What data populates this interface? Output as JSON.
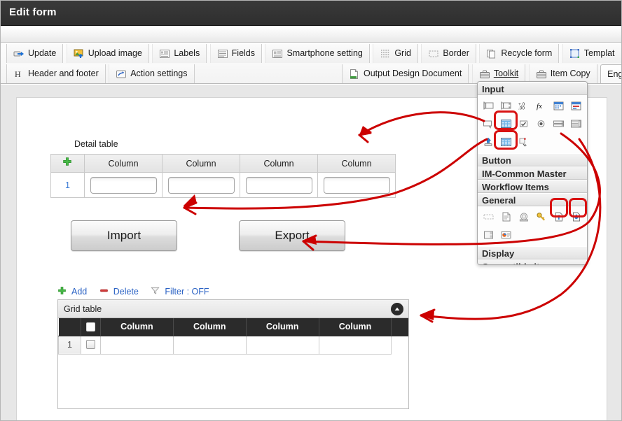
{
  "window": {
    "title": "Edit form"
  },
  "toolbar": {
    "row1": [
      {
        "label": "Update",
        "icon": "update-icon"
      },
      {
        "label": "Upload image",
        "icon": "upload-image-icon"
      },
      {
        "label": "Labels",
        "icon": "labels-icon"
      },
      {
        "label": "Fields",
        "icon": "fields-icon"
      },
      {
        "label": "Smartphone setting",
        "icon": "smartphone-setting-icon"
      },
      {
        "label": "Grid",
        "icon": "grid-icon"
      },
      {
        "label": "Border",
        "icon": "border-icon"
      },
      {
        "label": "Recycle form",
        "icon": "recycle-form-icon"
      },
      {
        "label": "Templat",
        "icon": "template-icon"
      }
    ],
    "row2_left": [
      {
        "label": "Header and footer",
        "icon": "header-footer-icon"
      },
      {
        "label": "Action settings",
        "icon": "action-settings-icon"
      }
    ],
    "row2_right": [
      {
        "label": "Output Design Document",
        "icon": "output-design-document-icon"
      },
      {
        "label": "Toolkit",
        "icon": "toolkit-icon"
      },
      {
        "label": "Item Copy",
        "icon": "item-copy-icon"
      },
      {
        "label": "Eng",
        "icon": "language-icon"
      }
    ]
  },
  "form": {
    "detail_table": {
      "label": "Detail table",
      "add_icon": "plus-icon",
      "columns": [
        "Column",
        "Column",
        "Column",
        "Column"
      ],
      "rows": [
        {
          "number": "1",
          "values": [
            "",
            "",
            "",
            ""
          ]
        }
      ]
    },
    "buttons": {
      "import": "Import",
      "export": "Export"
    },
    "grid_toolbar": [
      {
        "label": "Add",
        "icon": "plus-icon"
      },
      {
        "label": "Delete",
        "icon": "minus-icon"
      },
      {
        "label": "Filter : OFF",
        "icon": "filter-icon"
      }
    ],
    "grid_table": {
      "title": "Grid table",
      "collapse_icon": "chevron-up-icon",
      "columns": [
        "Column",
        "Column",
        "Column",
        "Column"
      ],
      "rows": [
        {
          "number": "1"
        }
      ]
    }
  },
  "toolkit_panel": {
    "sections": [
      {
        "name": "Input"
      },
      {
        "name": "Button"
      },
      {
        "name": "IM-Common Master"
      },
      {
        "name": "Workflow Items"
      },
      {
        "name": "General"
      },
      {
        "name": "Display"
      },
      {
        "name": "Compatible item"
      }
    ]
  },
  "colors": {
    "titlebar": "#343434",
    "accent_link": "#2a62c4",
    "highlight_red": "#d81212",
    "grid_header": "#2b2b2b",
    "plus_green": "#44b544",
    "minus_red": "#d23b3b"
  }
}
